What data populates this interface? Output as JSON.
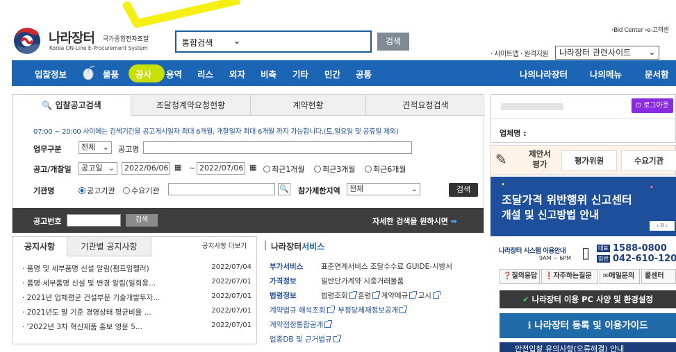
{
  "header": {
    "logo_name": "나라장터",
    "logo_sub_plain": "국가종합",
    "logo_sub_hl": "전자조달",
    "logo_eng": "Korea ON-Line E-Procurement System",
    "search_select": "통합검색",
    "search_button": "검색",
    "top_links": "›Bid Center  ›e-고객센",
    "sitemap_label": "· 사이트맵 · 원격지원",
    "site_select": "나라장터 관련사이트",
    "highlight_color": "#f5ef14"
  },
  "nav": {
    "items": [
      "입찰정보",
      "물품",
      "공사",
      "용역",
      "리스",
      "외자",
      "비축",
      "기타",
      "민간",
      "공통"
    ],
    "right_items": [
      "나의나라장터",
      "나의메뉴",
      "문서함"
    ],
    "active_item": "공사",
    "bg_color": "#1c64b4",
    "active_color": "#c8e000"
  },
  "search_panel": {
    "tabs": [
      "입찰공고검색",
      "조달청계약요청현황",
      "계약현황",
      "견적요청검색"
    ],
    "notice": "07:00 ~ 20:00 사이에는 검색기간을 공고게시일자 최대 6개월, 개찰일자 최대 6개월 까지 가능합니다.(토,일요일 및 공휴일 제외)",
    "business_label": "업무구분",
    "business_value": "전체",
    "title_label": "공고명",
    "date_label": "공고/개찰일",
    "date_type": "공고일",
    "date_from": "2022/06/06",
    "date_sep": "~",
    "date_to": "2022/07/06",
    "period_options": [
      "최근1개월",
      "최근3개월",
      "최근6개월"
    ],
    "agency_label": "기관명",
    "agency_options": [
      "공고기관",
      "수요기관"
    ],
    "region_label": "참가제한지역",
    "region_value": "전체",
    "search_button": "검색",
    "bid_no_label": "공고번호",
    "bid_no_button": "검색",
    "detail_search": "자세한 검색을 원하시면"
  },
  "notices": {
    "tabs": [
      "공지사항",
      "기관별 공지사항"
    ],
    "more": "공지사항 더보기",
    "rows": [
      {
        "title": "· 품명 및 세부품명 신설 알림(펌프임펠러)",
        "date": "2022/07/04"
      },
      {
        "title": "· 품명·세부품명 신설 및 변경 알림(일회용...",
        "date": "2022/07/01"
      },
      {
        "title": "· 2021년 업체평균 건설부문 기술개발투자...",
        "date": "2022/07/01"
      },
      {
        "title": "· 2021년도 말 기준 경영상태 평균비율 ...",
        "date": "2022/07/01"
      },
      {
        "title": "· '2022년 3차 혁신제품 홍보 영문 5...",
        "date": "2022/07/01"
      }
    ]
  },
  "services": {
    "title_plain": "나라장터",
    "title_hl": "서비스",
    "rows": [
      {
        "head": "부가서비스",
        "items": "표준연계서비스  조달수수료  GUIDE-시방서"
      },
      {
        "head": "가격정보",
        "items": "일반단가계약  시중거래물품"
      },
      {
        "head": "법령정보",
        "items": [
          "법령조회",
          "훈령",
          "계약예규",
          "고시"
        ]
      }
    ],
    "links": [
      "계약법규 해석조회",
      "부정당제재정보공개",
      "계약점정통합공개",
      "업종DB 및 근거법규"
    ]
  },
  "right": {
    "logout": "로그아웃",
    "company_label": "업체명 :",
    "eval_label": "제안서 평가",
    "eval_links": [
      "평가위원",
      "수요기관"
    ],
    "banner_line1": "조달가격 위반행위 신고센터",
    "banner_line2": "개설 및 신고방법 안내",
    "banner_pager": "‹ II ›",
    "helpdesk_title": "나라장터 시스템 이용안내",
    "helpdesk_hours": "9AM ~ 6PM",
    "helpdesk_tags": [
      "대표",
      "입반"
    ],
    "phone1": "1588-0800",
    "phone2": "042-610-1200",
    "quick": [
      "질의응답",
      "자주하는질문",
      "메일문의",
      "콜센터"
    ],
    "pc_spec": "나라장터 이용 PC 사양 및 환경설정",
    "guide": "나라장터 등록 및 이용가이드",
    "bottom_strip": "안전입찰 유의사항(오류해결) 안내"
  }
}
